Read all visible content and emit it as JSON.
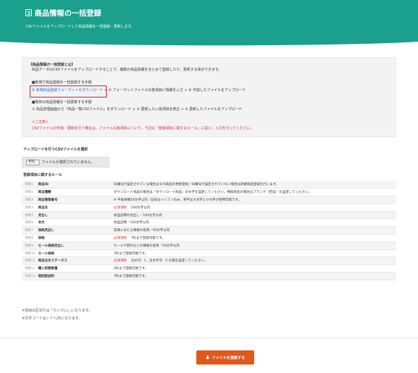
{
  "header": {
    "title": "商品情報の一括登録",
    "subtitle": "CSVファイルをアップロードして商品情報を一括登録・更新します。"
  },
  "info": {
    "heading": "【商品情報の一括登録とは】",
    "intro": "商品データのCSVファイルをアップロードすることで、複数の商品情報をまとめて登録したり、更新する事ができます。",
    "new_heading": "■新規で商品登録を一括登録する手順",
    "new_step1_prefix": "①",
    "new_step1_link": "新規商品登録フォーマットをダウンロード",
    "new_step2": "> ② フォーマットファイルの各項目に情報を入力 > ③ 作成したファイルをアップロード",
    "existing_heading": "■既存の商品情報を一括更新する手順",
    "existing_steps": "① 商品管理画面から「商品一覧CSVファイル」をダウンロード > ② 更新したい各項目を修正 > ③ 更新したファイルをアップロード",
    "caution_heading": "<ご注意>",
    "caution_text": "CSVファイルの作成・更新を行う場合は、ファイルの各項目について、下記の「登録項目に関するルール」に従い、入力を行ってください。"
  },
  "upload": {
    "label": "アップロードを行うCSVファイルを選択",
    "browse_button": "参照...",
    "file_status": "ファイルが選択されていません。"
  },
  "rules": {
    "heading": "登録項目に関するルール",
    "rows": [
      {
        "no": "項目1",
        "name": "商品ID",
        "required": "",
        "desc": "ID番号が設定されている場合はその商品の更新登録／ID番号が設定されていない場合は新規商品登録を行います。"
      },
      {
        "no": "項目2",
        "name": "商品種類",
        "required": "",
        "desc": "ダウンロード商品の場合は「ダウンロード商品」の文字を設定してください。物販商品の場合はブランク（空白）を設定してください。"
      },
      {
        "no": "項目3",
        "name": "商品管理番号",
        "required": "",
        "desc": "※ 半角英数50文字以内／記号はハイフンのみ、英字は大文字と小文字が使用可能です。"
      },
      {
        "no": "項目4",
        "name": "商品名",
        "required": "必須項目",
        "desc": "100文字以内"
      },
      {
        "no": "項目5",
        "name": "見出し",
        "required": "",
        "desc": "商品説明の見出し／100文字以内"
      },
      {
        "no": "項目6",
        "name": "本文",
        "required": "",
        "desc": "商品説明／100文字以内"
      },
      {
        "no": "項目7",
        "name": "価格見出し",
        "required": "",
        "desc": "定価にあたる価格の名称／50文字以内"
      },
      {
        "no": "項目8",
        "name": "価格",
        "required": "必須項目",
        "desc": "7桁まで登録可能です。"
      },
      {
        "no": "項目9",
        "name": "セール価格見出し",
        "required": "",
        "desc": "セールや割引などの価格の名称／50文字以内"
      },
      {
        "no": "項目10",
        "name": "セール価格",
        "required": "",
        "desc": "7桁まで登録可能です。"
      },
      {
        "no": "項目11",
        "name": "商品注文ステータス",
        "required": "必須項目",
        "desc": "注文可：1、注文不可：0 の値を設定してください。"
      },
      {
        "no": "項目12",
        "name": "購入制限数量",
        "required": "",
        "desc": "2桁まで登録可能です。"
      },
      {
        "no": "項目13",
        "name": "個別配送料",
        "required": "",
        "desc": "7桁まで登録可能です。"
      }
    ]
  },
  "notes": {
    "delimiter": "※項目の区切りは「カンマ(,)」になります。",
    "encoding": "※文字コードはシフトJISになります。"
  },
  "submit": {
    "label": "ファイルを登録する",
    "icon": "download-icon"
  },
  "colors": {
    "header_bg": "#1aa08c",
    "accent_red": "#d9282e",
    "link": "#1e6fcf",
    "submit_bg": "#e2571b"
  }
}
